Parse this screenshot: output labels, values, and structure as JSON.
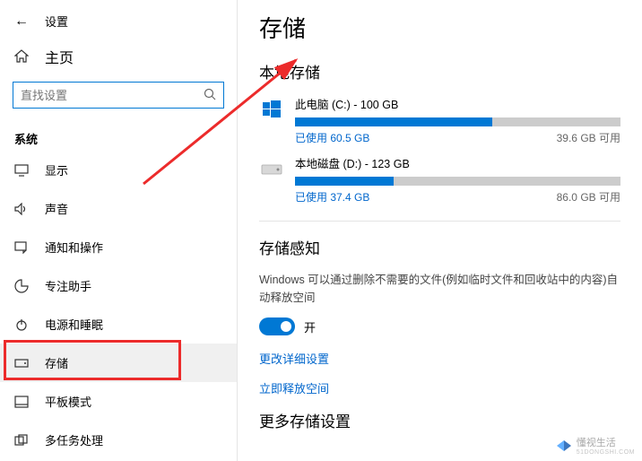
{
  "header": {
    "settings": "设置",
    "home": "主页"
  },
  "search": {
    "placeholder": "直找设置"
  },
  "section_label": "系统",
  "nav": [
    {
      "key": "display",
      "label": "显示"
    },
    {
      "key": "sound",
      "label": "声音"
    },
    {
      "key": "notifications",
      "label": "通知和操作"
    },
    {
      "key": "focus",
      "label": "专注助手"
    },
    {
      "key": "power",
      "label": "电源和睡眠"
    },
    {
      "key": "storage",
      "label": "存储"
    },
    {
      "key": "tablet",
      "label": "平板模式"
    },
    {
      "key": "multitask",
      "label": "多任务处理"
    }
  ],
  "page": {
    "title": "存储",
    "local_storage_title": "本地存储",
    "storage_sense_title": "存储感知",
    "more_storage_title": "更多存储设置"
  },
  "drives": [
    {
      "name": "此电脑 (C:) - 100 GB",
      "used_label": "已使用 60.5 GB",
      "free_label": "39.6 GB 可用",
      "used_pct": 60.5,
      "icon": "windows"
    },
    {
      "name": "本地磁盘 (D:) - 123 GB",
      "used_label": "已使用 37.4 GB",
      "free_label": "86.0 GB 可用",
      "used_pct": 30.4,
      "icon": "disk"
    }
  ],
  "sense": {
    "desc": "Windows 可以通过删除不需要的文件(例如临时文件和回收站中的内容)自动释放空间",
    "toggle_on": true,
    "toggle_label": "开",
    "link_configure": "更改详细设置",
    "link_freenow": "立即释放空间"
  },
  "watermark": {
    "brand": "懂视生活",
    "sub": "51DONGSHI.COM"
  }
}
